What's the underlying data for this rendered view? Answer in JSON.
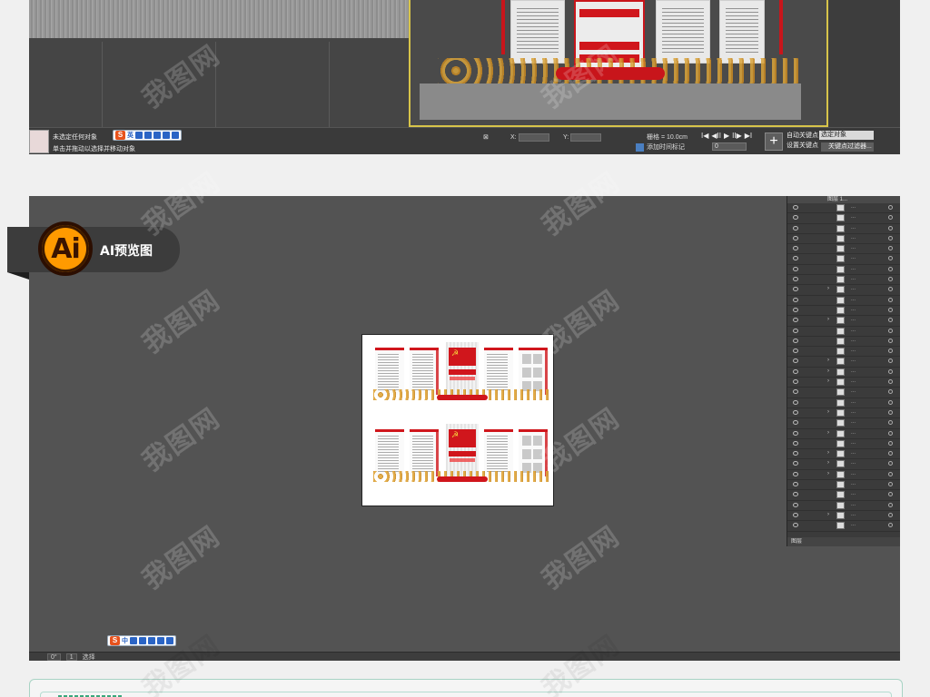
{
  "max_panel": {
    "status_line1": "未选定任何对象",
    "status_line2": "单击并拖动以选择并移动对象",
    "ime": {
      "logo": "S",
      "mode": "英"
    },
    "coords": [
      {
        "axis": "X:"
      },
      {
        "axis": "Y:"
      }
    ],
    "grid_label": "栅格 = 10.0cm",
    "time_tag": "添加时间标记",
    "play_controls": [
      "I◀",
      "◀II",
      "▶",
      "II▶",
      "▶I"
    ],
    "frame_value": "0",
    "auto_key": "自动关键点",
    "set_key": "设置关键点",
    "selection_dropdown": "选定对象",
    "key_filter": "关键点过滤器..."
  },
  "ai_panel": {
    "badge_logo": "Ai",
    "badge_text": "AI预览图",
    "ime": {
      "logo": "S",
      "mode": "中"
    },
    "bottom_zoom": "0°",
    "bottom_page": "1",
    "bottom_tool": "选择",
    "layers_head": "图层 1...",
    "layers_foot": "图层",
    "layer_dots": "...",
    "flag_emblem": "☭"
  },
  "watermark": "我图网"
}
